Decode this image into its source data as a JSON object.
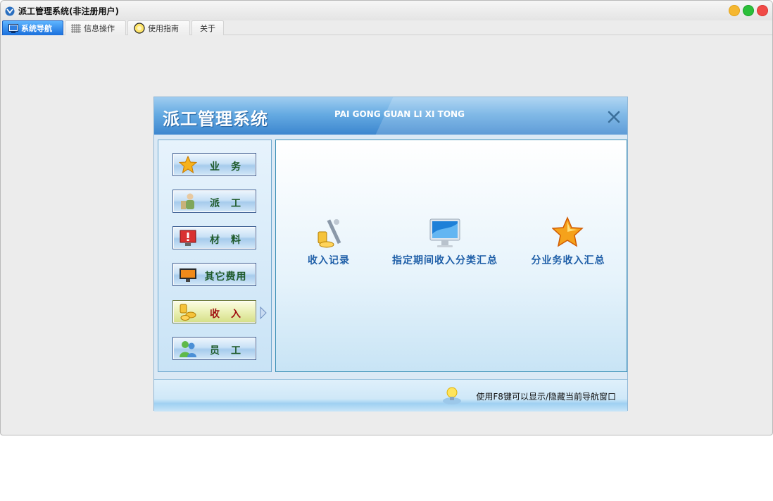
{
  "window": {
    "title": "派工管理系统(非注册用户)"
  },
  "tabs": [
    {
      "label": "系统导航",
      "icon": "monitor-icon",
      "active": true
    },
    {
      "label": "信息操作",
      "icon": "grid-icon",
      "active": false
    },
    {
      "label": "使用指南",
      "icon": "lightbulb-icon",
      "active": false
    },
    {
      "label": "关于",
      "icon": "",
      "active": false
    }
  ],
  "dialog": {
    "title": "派工管理系统",
    "subtitle": "PAI GONG GUAN LI XI TONG",
    "close_icon": "close-icon"
  },
  "nav": {
    "items": [
      {
        "label": "业　务",
        "icon": "star-icon",
        "active": false
      },
      {
        "label": "派　工",
        "icon": "worker-icon",
        "active": false
      },
      {
        "label": "材　料",
        "icon": "warning-monitor-icon",
        "active": false
      },
      {
        "label": "其它费用",
        "icon": "display-icon",
        "active": false
      },
      {
        "label": "收　入",
        "icon": "coins-icon",
        "active": true
      },
      {
        "label": "员　工",
        "icon": "users-icon",
        "active": false
      }
    ]
  },
  "content": {
    "items": [
      {
        "label": "收入记录",
        "icon": "coins-chart-icon"
      },
      {
        "label": "指定期间收入分类汇总",
        "icon": "imac-icon"
      },
      {
        "label": "分业务收入汇总",
        "icon": "star-icon"
      }
    ]
  },
  "footer": {
    "hint": "使用F8键可以显示/隐藏当前导航窗口"
  },
  "colors": {
    "accent": "#1a6fdc",
    "dialog_header": "#3c86cf",
    "content_label": "#1f5fa8"
  }
}
